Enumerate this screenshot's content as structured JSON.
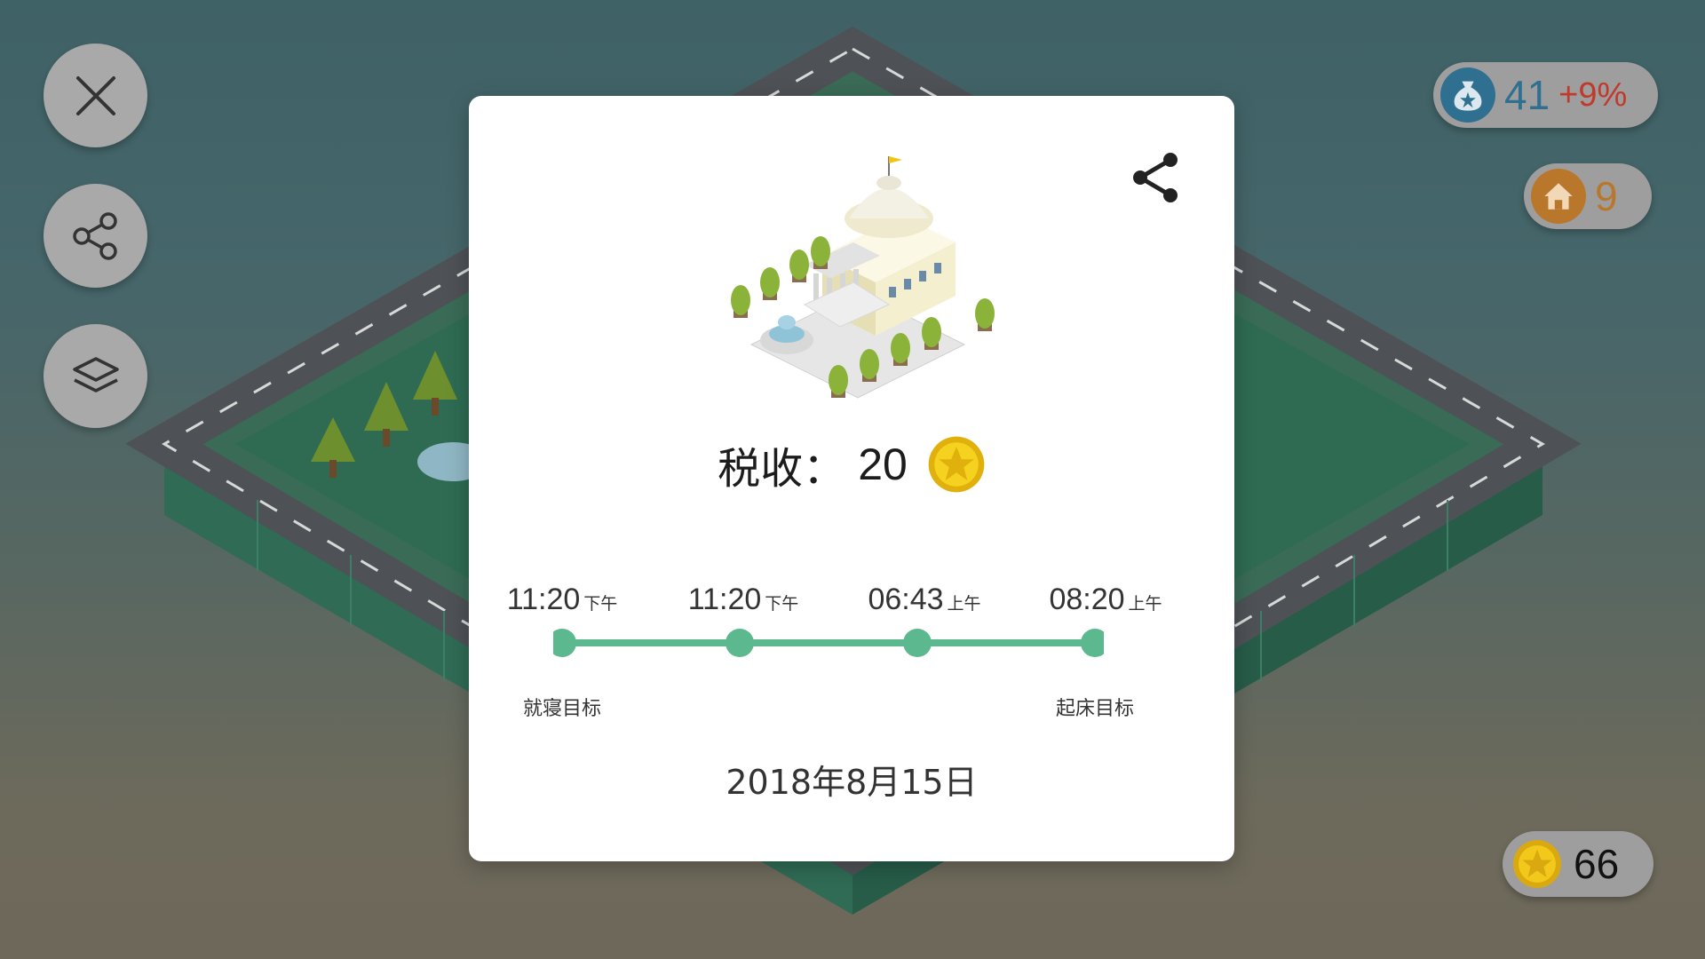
{
  "left_buttons": {
    "close_icon": "close-icon",
    "share_icon": "share-icon",
    "layers_icon": "layers-icon"
  },
  "stats": {
    "population": {
      "value": "41",
      "change": "+9%",
      "icon": "money-bag-icon"
    },
    "houses": {
      "value": "9",
      "icon": "house-icon"
    },
    "coins": {
      "value": "66",
      "icon": "coin-icon"
    }
  },
  "modal": {
    "tax_label": "税收：",
    "tax_value": "20",
    "share_icon": "share-icon",
    "times": [
      {
        "time": "11:20",
        "period": "下午"
      },
      {
        "time": "11:20",
        "period": "下午"
      },
      {
        "time": "06:43",
        "period": "上午"
      },
      {
        "time": "08:20",
        "period": "上午"
      }
    ],
    "bedtime_label": "就寝目标",
    "wakeup_label": "起床目标",
    "date": "2018年8月15日"
  },
  "colors": {
    "timeline": "#5cb88f",
    "coin": "#f2c81a",
    "stat_blue": "#2f6f8f",
    "stat_red": "#c0392b",
    "house_orange": "#b9772c"
  }
}
